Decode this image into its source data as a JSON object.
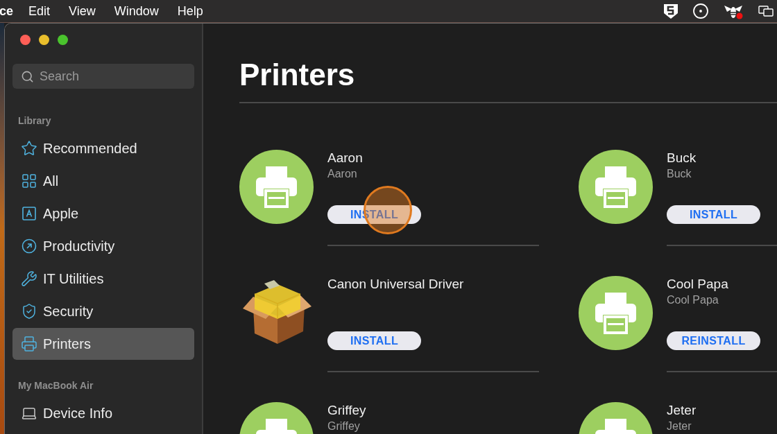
{
  "menu_bar": {
    "app_name": "ce",
    "menus": [
      "Edit",
      "View",
      "Window",
      "Help"
    ]
  },
  "sidebar": {
    "search": {
      "placeholder": "Search"
    },
    "sections": [
      {
        "title": "Library",
        "items": [
          {
            "label": "Recommended",
            "kind": "star",
            "selected": false
          },
          {
            "label": "All",
            "kind": "grid",
            "selected": false
          },
          {
            "label": "Apple",
            "kind": "letter",
            "selected": false
          },
          {
            "label": "Productivity",
            "kind": "arrow",
            "selected": false
          },
          {
            "label": "IT Utilities",
            "kind": "tools",
            "selected": false
          },
          {
            "label": "Security",
            "kind": "shield",
            "selected": false
          },
          {
            "label": "Printers",
            "kind": "printer",
            "selected": true
          }
        ]
      },
      {
        "title": "My MacBook Air",
        "items": [
          {
            "label": "Device Info",
            "kind": "laptop",
            "selected": false
          }
        ]
      }
    ]
  },
  "page": {
    "title": "Printers",
    "items": [
      {
        "name": "Aaron",
        "subtitle": "Aaron",
        "kind": "printer",
        "button": "INSTALL",
        "click_highlight": true
      },
      {
        "name": "Buck",
        "subtitle": "Buck",
        "kind": "printer",
        "button": "INSTALL",
        "click_highlight": false
      },
      {
        "name": "Canon Universal Driver",
        "kind": "package",
        "button": "INSTALL",
        "click_highlight": false
      },
      {
        "name": "Cool Papa",
        "subtitle": "Cool Papa",
        "kind": "printer",
        "button": "REINSTALL",
        "click_highlight": false
      },
      {
        "name": "Griffey",
        "subtitle": "Griffey",
        "kind": "printer",
        "click_highlight": false
      },
      {
        "name": "Jeter",
        "subtitle": "Jeter",
        "kind": "printer",
        "click_highlight": false
      }
    ]
  }
}
